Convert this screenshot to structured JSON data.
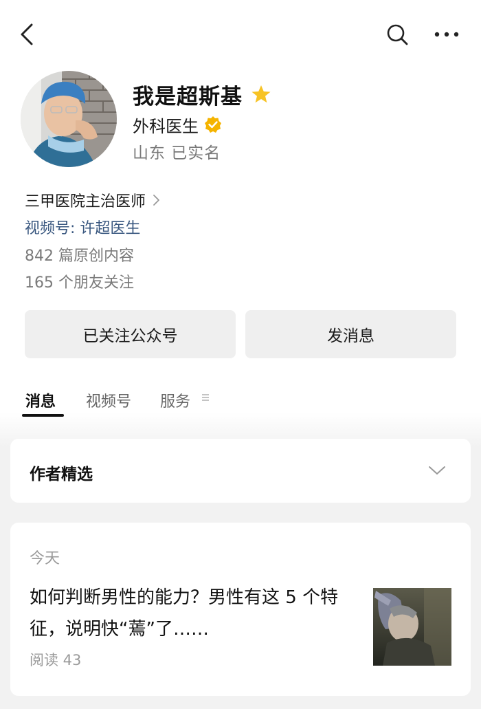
{
  "header": {
    "back_icon": "back-arrow-icon",
    "search_icon": "search-icon",
    "more_icon": "more-dots-icon"
  },
  "profile": {
    "name": "我是超斯基",
    "profession": "外科医生",
    "location": "山东 已实名",
    "organization": "三甲医院主治医师",
    "video_channel": "视频号: 许超医生",
    "original_count": "842 篇原创内容",
    "friends_following": "165 个朋友关注",
    "star_color": "#f7c325",
    "verify_color": "#f5b400"
  },
  "actions": {
    "follow_label": "已关注公众号",
    "message_label": "发消息"
  },
  "tabs": [
    {
      "label": "消息",
      "active": true
    },
    {
      "label": "视频号",
      "active": false
    },
    {
      "label": "服务",
      "active": false
    }
  ],
  "featured": {
    "title": "作者精选"
  },
  "article": {
    "date": "今天",
    "title": "如何判断男性的能力？男性有这 5 个特征，说明快“蔫”了……",
    "reads": "阅读 43"
  }
}
